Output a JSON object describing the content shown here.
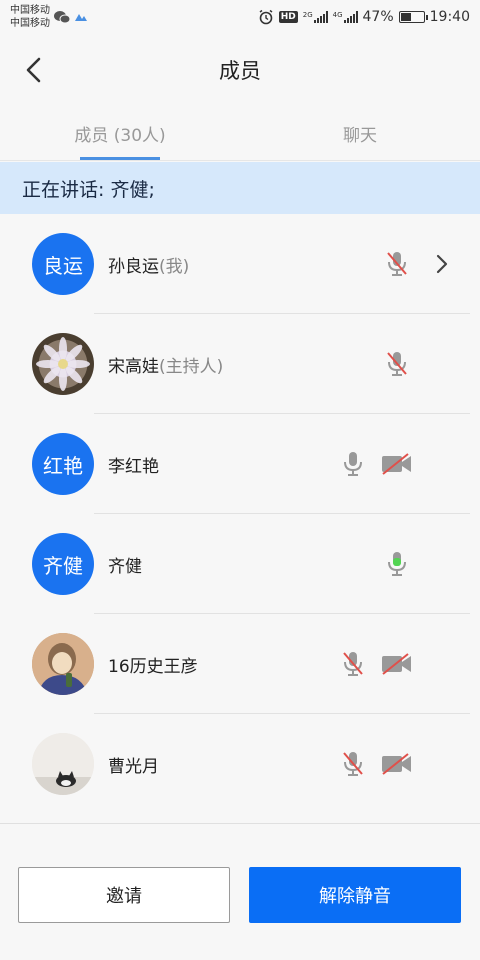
{
  "status_bar": {
    "carrier_1": "中国移动",
    "carrier_2": "中国移动",
    "battery": "47%",
    "time": "19:40",
    "hd": "HD",
    "net_1": "2G",
    "net_2": "4G"
  },
  "header": {
    "title": "成员"
  },
  "tabs": [
    {
      "label": "成员 (30人)",
      "active": true
    },
    {
      "label": "聊天",
      "active": false
    }
  ],
  "speaking": {
    "text": "正在讲话: 齐健;"
  },
  "members": [
    {
      "name": "孙良运",
      "role": "(我)",
      "avatar_text": "良运",
      "mic": "muted",
      "camera": "none",
      "has_chevron": true
    },
    {
      "name": "宋高娃",
      "role": "(主持人)",
      "avatar_text": "",
      "avatar_type": "flower-photo",
      "mic": "muted",
      "camera": "none",
      "has_chevron": false
    },
    {
      "name": "李红艳",
      "role": "",
      "avatar_text": "红艳",
      "mic": "on",
      "camera": "off",
      "has_chevron": false
    },
    {
      "name": "齐健",
      "role": "",
      "avatar_text": "齐健",
      "mic": "speaking",
      "camera": "none",
      "has_chevron": false
    },
    {
      "name": "16历史王彦",
      "role": "",
      "avatar_text": "",
      "avatar_type": "cartoon-photo",
      "mic": "muted",
      "camera": "off",
      "has_chevron": false
    },
    {
      "name": "曹光月",
      "role": "",
      "avatar_text": "",
      "avatar_type": "cat-photo",
      "mic": "muted",
      "camera": "off",
      "has_chevron": false
    }
  ],
  "buttons": {
    "invite": "邀请",
    "unmute": "解除静音"
  },
  "colors": {
    "accent": "#0a6ef5",
    "avatar_blue": "#1a73f0",
    "muted_red": "#e0504a",
    "speaking_green": "#52d452",
    "banner": "#d6e8fb"
  }
}
